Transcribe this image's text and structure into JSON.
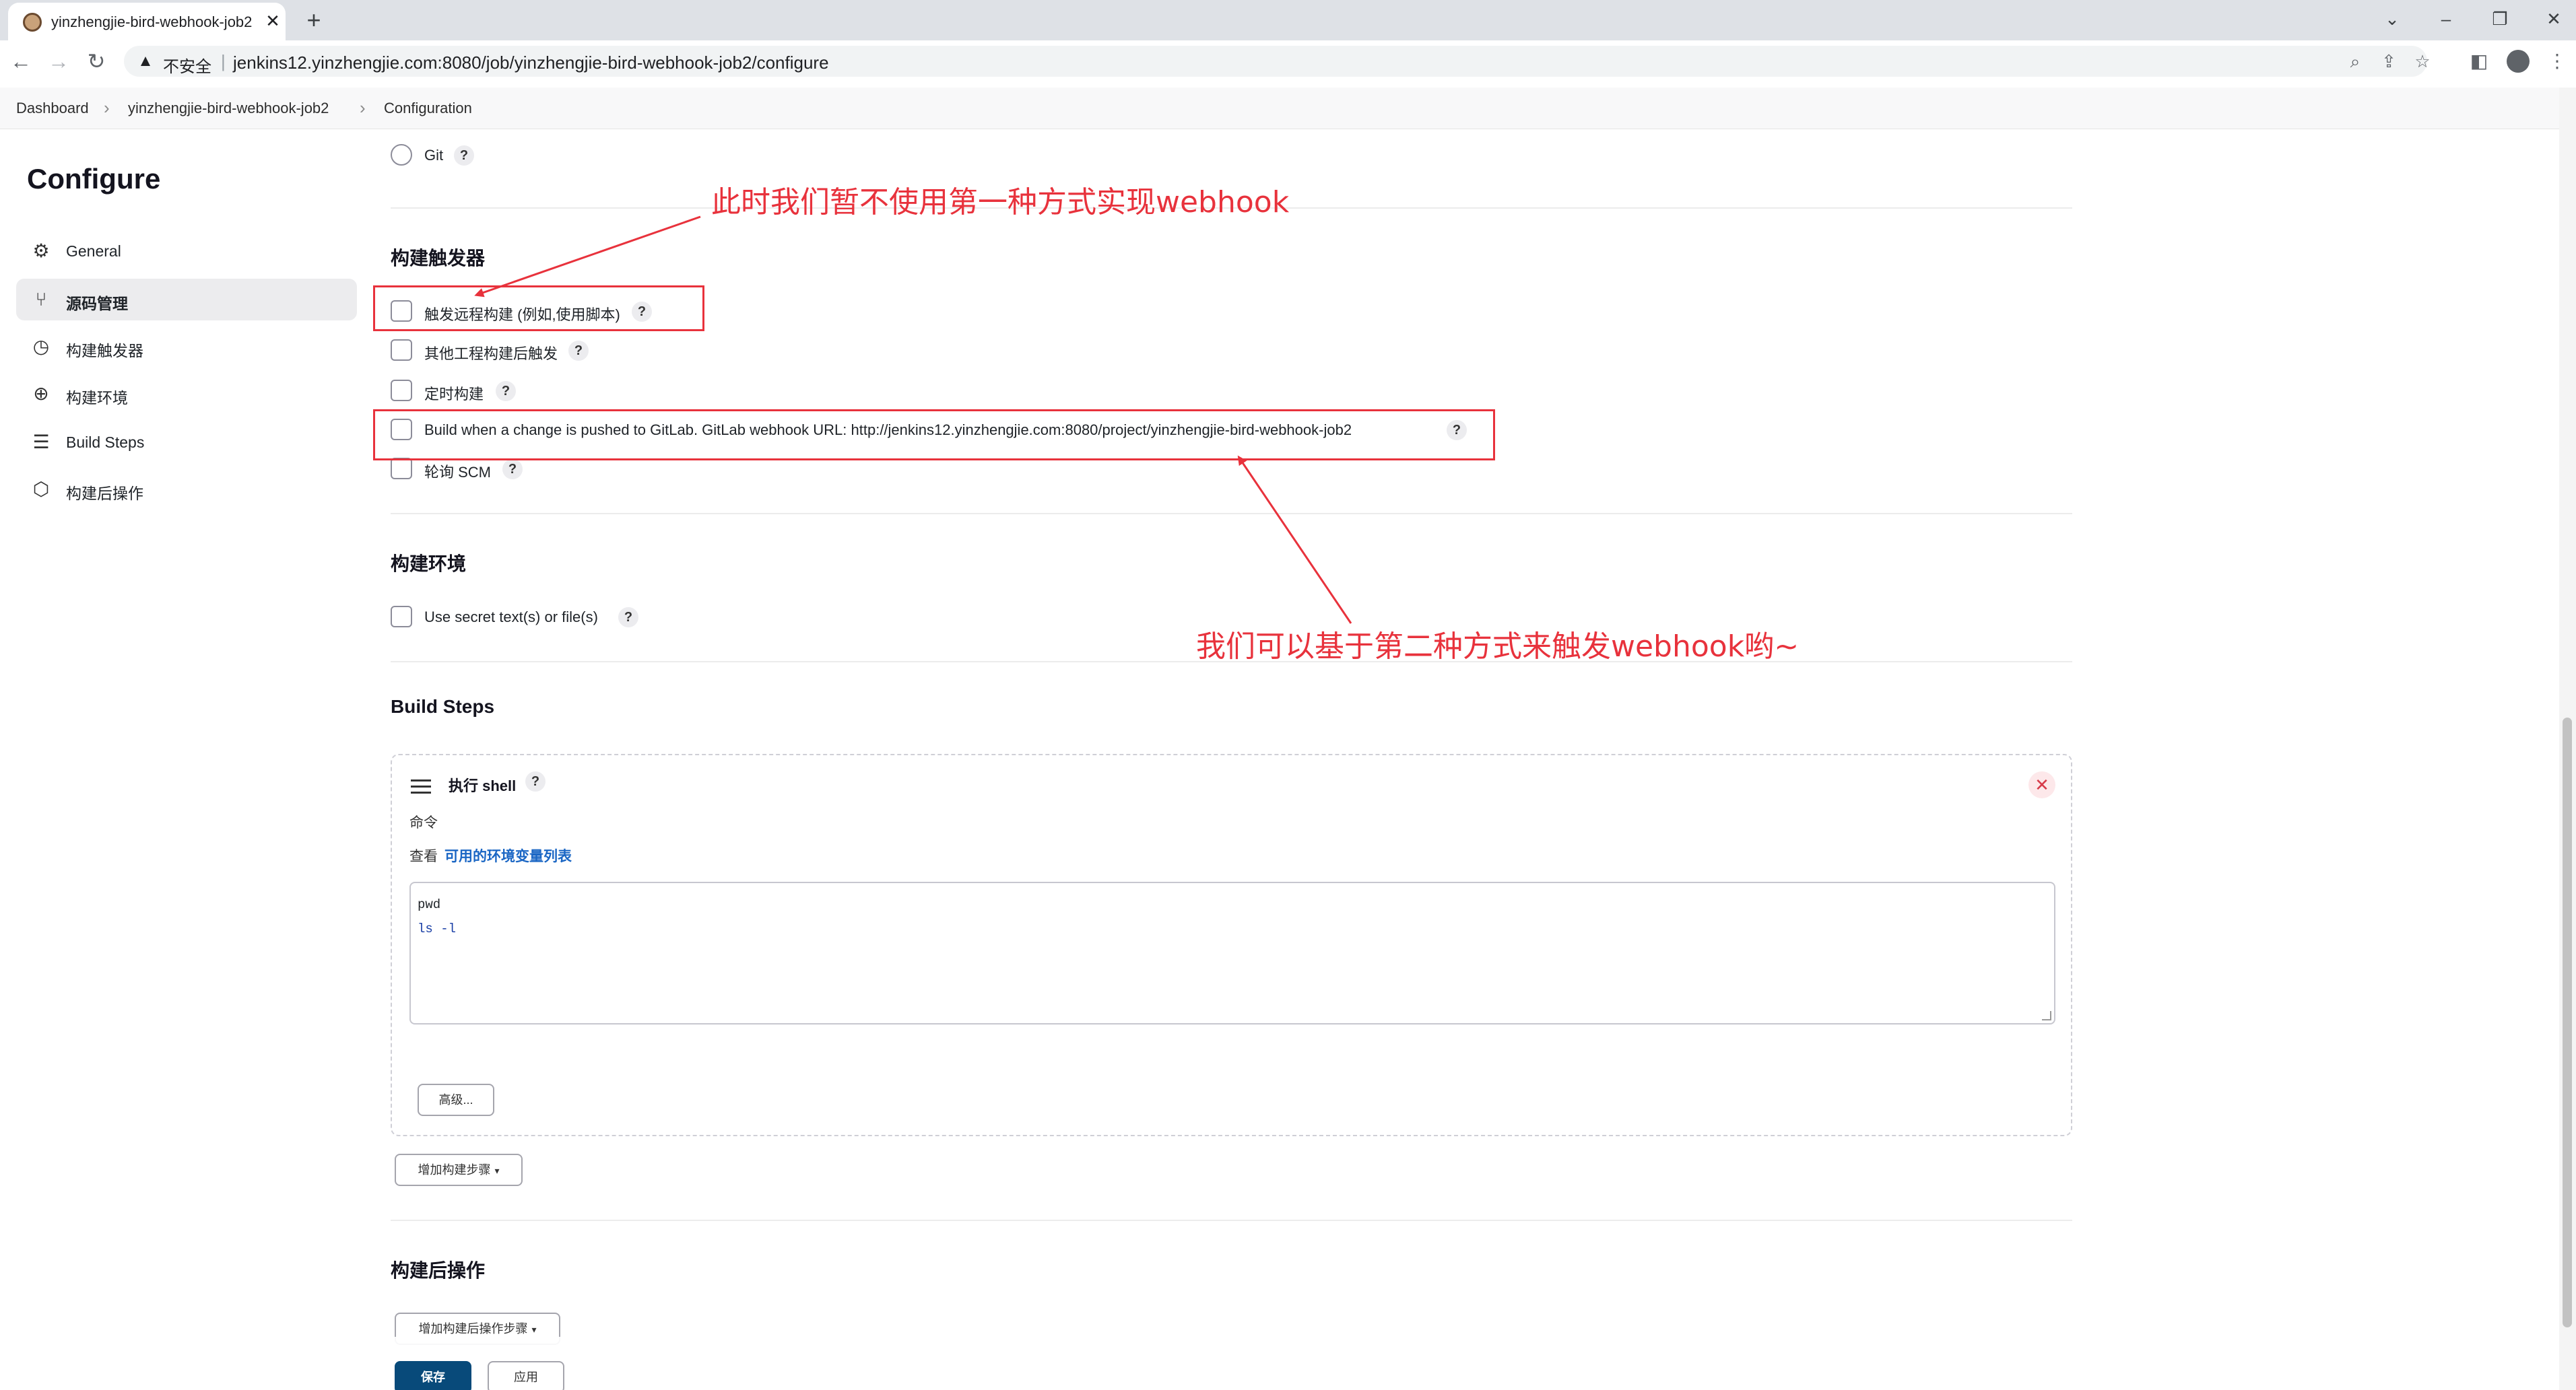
{
  "browser": {
    "tab_title": "yinzhengjie-bird-webhook-job2",
    "tab_close": "✕",
    "new_tab": "+",
    "security_label": "不安全",
    "url": "jenkins12.yinzhengjie.com:8080/job/yinzhengjie-bird-webhook-job2/configure"
  },
  "breadcrumb": {
    "items": [
      "Dashboard",
      "yinzhengjie-bird-webhook-job2",
      "Configuration"
    ]
  },
  "sidebar": {
    "title": "Configure",
    "items": [
      {
        "label": "General",
        "icon": "gear-icon"
      },
      {
        "label": "源码管理",
        "icon": "branch-icon",
        "active": true
      },
      {
        "label": "构建触发器",
        "icon": "clock-icon"
      },
      {
        "label": "构建环境",
        "icon": "globe-icon"
      },
      {
        "label": "Build Steps",
        "icon": "list-icon"
      },
      {
        "label": "构建后操作",
        "icon": "cube-icon"
      }
    ]
  },
  "scm": {
    "git_label": "Git"
  },
  "triggers": {
    "heading": "构建触发器",
    "options": [
      "触发远程构建 (例如,使用脚本)",
      "其他工程构建后触发",
      "定时构建",
      "Build when a change is pushed to GitLab. GitLab webhook URL: http://jenkins12.yinzhengjie.com:8080/project/yinzhengjie-bird-webhook-job2",
      "轮询 SCM"
    ]
  },
  "environment": {
    "heading": "构建环境",
    "secret_option": "Use secret text(s) or file(s)"
  },
  "build_steps": {
    "heading": "Build Steps",
    "step_title": "执行 shell",
    "command_label": "命令",
    "env_prefix": "查看",
    "env_link": "可用的环境变量列表",
    "command_lines": [
      "pwd",
      "ls -l"
    ],
    "advanced_button": "高级...",
    "add_step_button": "增加构建步骤"
  },
  "post_build": {
    "heading": "构建后操作",
    "add_post_step_button": "增加构建后操作步骤"
  },
  "actions": {
    "save": "保存",
    "apply": "应用"
  },
  "annotations": {
    "top_note": "此时我们暂不使用第一种方式实现webhook",
    "bottom_note": "我们可以基于第二种方式来触发webhook哟~",
    "color": "#e8323c"
  },
  "colors": {
    "primary_button": "#084a7a",
    "link": "#1a66c4",
    "annotation_red": "#e8323c"
  }
}
